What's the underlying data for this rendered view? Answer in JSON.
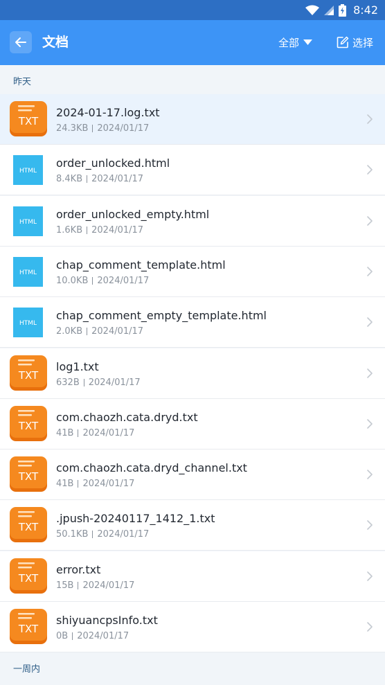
{
  "status": {
    "time": "8:42"
  },
  "header": {
    "title": "文档",
    "filter_label": "全部",
    "select_label": "选择"
  },
  "sections": [
    {
      "label": "昨天",
      "files": [
        {
          "name": "2024-01-17.log.txt",
          "size": "24.3KB",
          "date": "2024/01/17",
          "type": "TXT"
        },
        {
          "name": "order_unlocked.html",
          "size": "8.4KB",
          "date": "2024/01/17",
          "type": "HTML"
        },
        {
          "name": "order_unlocked_empty.html",
          "size": "1.6KB",
          "date": "2024/01/17",
          "type": "HTML"
        },
        {
          "name": "chap_comment_template.html",
          "size": "10.0KB",
          "date": "2024/01/17",
          "type": "HTML"
        },
        {
          "name": "chap_comment_empty_template.html",
          "size": "2.0KB",
          "date": "2024/01/17",
          "type": "HTML"
        },
        {
          "name": "log1.txt",
          "size": "632B",
          "date": "2024/01/17",
          "type": "TXT"
        },
        {
          "name": "com.chaozh.cata.dryd.txt",
          "size": "41B",
          "date": "2024/01/17",
          "type": "TXT"
        },
        {
          "name": "com.chaozh.cata.dryd_channel.txt",
          "size": "41B",
          "date": "2024/01/17",
          "type": "TXT"
        },
        {
          "name": ".jpush-20240117_1412_1.txt",
          "size": "50.1KB",
          "date": "2024/01/17",
          "type": "TXT"
        },
        {
          "name": "error.txt",
          "size": "15B",
          "date": "2024/01/17",
          "type": "TXT"
        },
        {
          "name": "shiyuancpsInfo.txt",
          "size": "0B",
          "date": "2024/01/17",
          "type": "TXT"
        }
      ]
    },
    {
      "label": "一周内",
      "files": []
    }
  ],
  "icons": {
    "back": "arrow-left-icon",
    "filter": "caret-down-icon",
    "select": "edit-icon",
    "row": "chevron-right-icon",
    "txt_icon_color": "#f5891f",
    "html_icon_color": "#36b9ee"
  },
  "colors": {
    "status_bar": "#2d6fc4",
    "app_bar": "#3d94f6",
    "section_bg": "#f1f5f9",
    "section_text": "#2e5d86",
    "highlight_row": "#eaf3fd"
  }
}
